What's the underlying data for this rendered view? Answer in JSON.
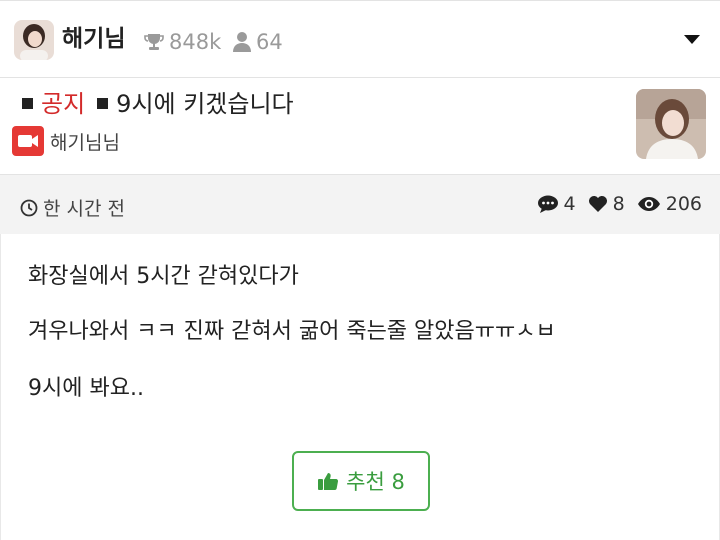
{
  "channel": {
    "name": "해기님",
    "trophy_count": "848k",
    "member_count": "64",
    "menu_icon": "caret-down-icon"
  },
  "post": {
    "notice_tag": "공지",
    "title": "9시에 키겠습니다",
    "author": "해기님님",
    "author_icon": "video-camera-icon",
    "time": "한 시간 전",
    "comments": "4",
    "likes": "8",
    "views": "206",
    "body": [
      "화장실에서 5시간 갇혀있다가",
      "겨우나와서 ㅋㅋ 진짜 갇혀서 굶어 죽는줄 알았음ㅠㅠㅅㅂ",
      "9시에 봐요.."
    ],
    "recommend_label": "추천 8"
  },
  "colors": {
    "notice": "#d32a2a",
    "recommend": "#4caf50",
    "camera": "#e53935",
    "meta_bg": "#f3f3f3"
  }
}
